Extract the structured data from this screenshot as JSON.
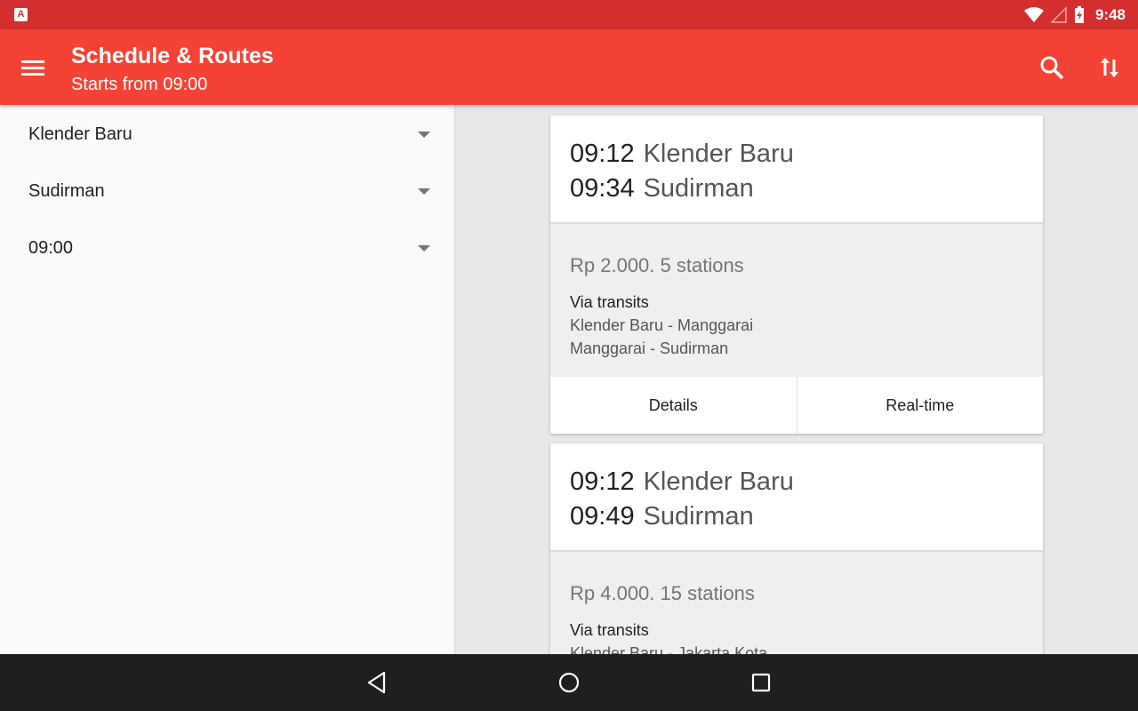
{
  "statusbar": {
    "time": "9:48",
    "notif_glyph": "A"
  },
  "appbar": {
    "title": "Schedule & Routes",
    "subtitle": "Starts from 09:00"
  },
  "filters": [
    {
      "value": "Klender Baru"
    },
    {
      "value": "Sudirman"
    },
    {
      "value": "09:00"
    }
  ],
  "results": [
    {
      "depart_time": "09:12",
      "depart_station": "Klender Baru",
      "arrive_time": "09:34",
      "arrive_station": "Sudirman",
      "fare": "Rp 2.000. 5 stations",
      "via_label": "Via transits",
      "legs": [
        "Klender Baru - Manggarai",
        "Manggarai - Sudirman"
      ],
      "actions": [
        "Details",
        "Real-time"
      ]
    },
    {
      "depart_time": "09:12",
      "depart_station": "Klender Baru",
      "arrive_time": "09:49",
      "arrive_station": "Sudirman",
      "fare": "Rp 4.000. 15 stations",
      "via_label": "Via transits",
      "legs": [
        "Klender Baru - Jakarta Kota"
      ]
    }
  ],
  "colors": {
    "primary": "#f44336",
    "status": "#d32f2f",
    "nav": "#1f1f1f"
  }
}
